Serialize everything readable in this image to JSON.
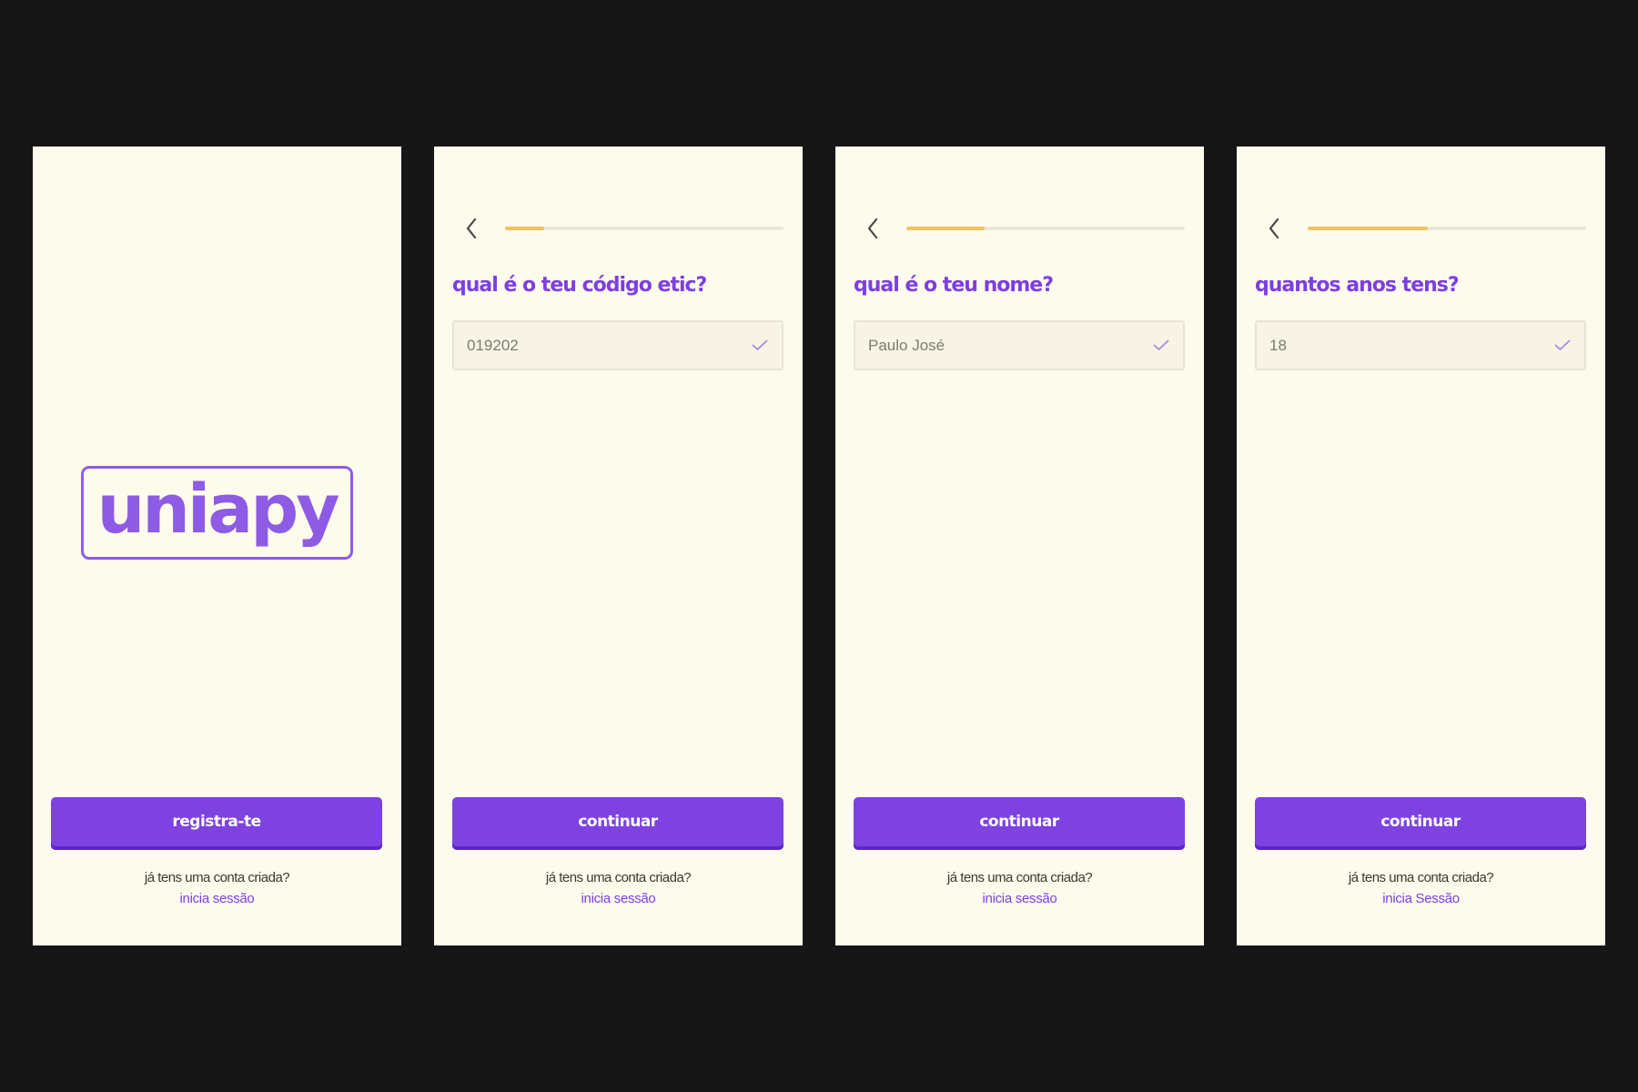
{
  "colors": {
    "background": "#161616",
    "screen": "#fdfbec",
    "accent": "#7d42e0",
    "progress": "#f4c064"
  },
  "welcome": {
    "logo": "uniapy",
    "cta_label": "registra-te",
    "footer_prompt": "já tens uma conta criada?",
    "footer_link": "inicia sessão"
  },
  "steps": [
    {
      "progress": 0.14,
      "question": "qual é o teu código etic?",
      "value": "019202",
      "cta_label": "continuar",
      "footer_prompt": "já tens uma conta criada?",
      "footer_link": "inicia sessão"
    },
    {
      "progress": 0.28,
      "question": "qual é o teu nome?",
      "value": "Paulo José",
      "cta_label": "continuar",
      "footer_prompt": "já tens uma conta criada?",
      "footer_link": "inicia sessão"
    },
    {
      "progress": 0.43,
      "question": "quantos anos tens?",
      "value": "18",
      "cta_label": "continuar",
      "footer_prompt": "já tens uma conta criada?",
      "footer_link": "inicia Sessão"
    }
  ],
  "icons": {
    "back": "chevron-left-icon",
    "valid": "check-icon"
  }
}
